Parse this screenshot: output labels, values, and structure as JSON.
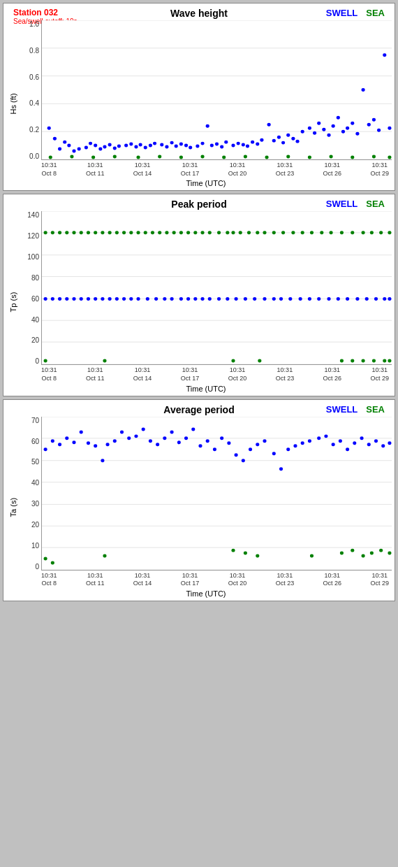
{
  "charts": [
    {
      "id": "wave-height",
      "title": "Wave height",
      "station": "Station 032",
      "cutoff": "Sea/swell cutoff: 10s",
      "y_label": "Hs (ft)",
      "y_ticks": [
        "1.0",
        "0.8",
        "0.6",
        "0.4",
        "0.2",
        "0.0"
      ],
      "legend_swell": "SWELL",
      "legend_sea": "SEA",
      "x_ticks": [
        {
          "line1": "10:31",
          "line2": "Oct 8"
        },
        {
          "line1": "10:31",
          "line2": "Oct 11"
        },
        {
          "line1": "10:31",
          "line2": "Oct 14"
        },
        {
          "line1": "10:31",
          "line2": "Oct 17"
        },
        {
          "line1": "10:31",
          "line2": "Oct 20"
        },
        {
          "line1": "10:31",
          "line2": "Oct 23"
        },
        {
          "line1": "10:31",
          "line2": "Oct 26"
        },
        {
          "line1": "10:31",
          "line2": "Oct 29"
        }
      ],
      "x_label": "Time (UTC)"
    },
    {
      "id": "peak-period",
      "title": "Peak period",
      "y_label": "Tp (s)",
      "y_ticks": [
        "140",
        "120",
        "100",
        "80",
        "60",
        "40",
        "20",
        "0"
      ],
      "legend_swell": "SWELL",
      "legend_sea": "SEA",
      "x_ticks": [
        {
          "line1": "10:31",
          "line2": "Oct 8"
        },
        {
          "line1": "10:31",
          "line2": "Oct 11"
        },
        {
          "line1": "10:31",
          "line2": "Oct 14"
        },
        {
          "line1": "10:31",
          "line2": "Oct 17"
        },
        {
          "line1": "10:31",
          "line2": "Oct 20"
        },
        {
          "line1": "10:31",
          "line2": "Oct 23"
        },
        {
          "line1": "10:31",
          "line2": "Oct 26"
        },
        {
          "line1": "10:31",
          "line2": "Oct 29"
        }
      ],
      "x_label": "Time (UTC)"
    },
    {
      "id": "avg-period",
      "title": "Average period",
      "y_label": "Ta (s)",
      "y_ticks": [
        "70",
        "60",
        "50",
        "40",
        "30",
        "20",
        "10",
        "0"
      ],
      "legend_swell": "SWELL",
      "legend_sea": "SEA",
      "x_ticks": [
        {
          "line1": "10:31",
          "line2": "Oct 8"
        },
        {
          "line1": "10:31",
          "line2": "Oct 11"
        },
        {
          "line1": "10:31",
          "line2": "Oct 14"
        },
        {
          "line1": "10:31",
          "line2": "Oct 17"
        },
        {
          "line1": "10:31",
          "line2": "Oct 20"
        },
        {
          "line1": "10:31",
          "line2": "Oct 23"
        },
        {
          "line1": "10:31",
          "line2": "Oct 26"
        },
        {
          "line1": "10:31",
          "line2": "Oct 29"
        }
      ],
      "x_label": "Time (UTC)"
    }
  ]
}
